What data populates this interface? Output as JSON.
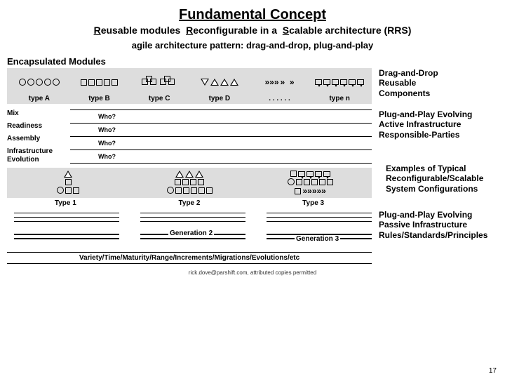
{
  "title": "Fundamental Concept",
  "subtitle_parts": {
    "r": "R",
    "eusable": "eusable modules",
    "r2": "R",
    "econfig": "econfigurable in a",
    "s": "S",
    "calable": "calable architecture (RRS)"
  },
  "subtitle2": "agile architecture pattern: drag-and-drop, plug-and-play",
  "modules_header": "Encapsulated Modules",
  "module_bins": {
    "a": "type A",
    "b": "type B",
    "c": "type C",
    "d": "type D",
    "dots": ". . . . . .",
    "n": "type n"
  },
  "side1": {
    "l1": "Drag-and-Drop",
    "l2": "Reusable",
    "l3": "Components"
  },
  "infra_rows": {
    "mix": "Mix",
    "readiness": "Readiness",
    "assembly": "Assembly",
    "evolution_l1": "Infrastructure",
    "evolution_l2": "Evolution",
    "who": "Who?"
  },
  "side2": {
    "l1": "Plug-and-Play Evolving",
    "l2": "Active Infrastructure",
    "l3": "Responsible-Parties"
  },
  "side3": {
    "l1": "Examples of Typical",
    "l2": "Reconfigurable/Scalable",
    "l3": "System Configurations"
  },
  "type_labels": {
    "t1": "Type 1",
    "t2": "Type 2",
    "t3": "Type 3"
  },
  "generations": {
    "g2": "Generation 2",
    "g3": "Generation 3"
  },
  "side4": {
    "l1": "Plug-and-Play Evolving",
    "l2": "Passive Infrastructure",
    "l3": "Rules/Standards/Principles"
  },
  "axis_label": "Variety/Time/Maturity/Range/Increments/Migrations/Evolutions/etc",
  "footer": "rick.dove@parshift.com, attributed copies permitted",
  "page": "17"
}
